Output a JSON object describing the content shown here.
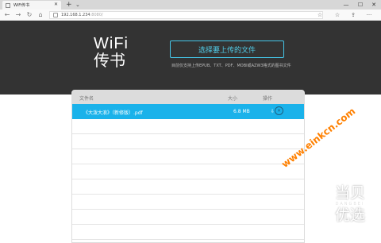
{
  "browser": {
    "tab_title": "WiFi传书",
    "tab_close": "✕",
    "new_tab": "+",
    "tab_list": "⌄",
    "url_host": "192.168.1.234",
    "url_port": ":8080/",
    "back": "←",
    "forward": "→",
    "refresh": "↻",
    "home": "⌂",
    "win_min": "—",
    "win_max": "☐",
    "win_close": "✕",
    "fav_star": "☆",
    "collections": "☆",
    "share": "⇪",
    "more": "···"
  },
  "header": {
    "brand_line1": "WiFi",
    "brand_line2": "传书",
    "upload_button": "选择要上传的文件",
    "hint_text": "目前仅支持上传EPUB、TXT、PDF、MOBI或AZW3格式的图书文件"
  },
  "file_list": {
    "columns": {
      "name": "文件名",
      "size": "大小",
      "actions": "操作"
    },
    "files": [
      {
        "name": "《大泼大浪》（新修版）.pdf",
        "size": "6.8 MB",
        "download_icon": "⇩",
        "delete_icon": "✕"
      }
    ]
  },
  "watermark": {
    "site": "www.einkcn.com",
    "logo_top": "当贝",
    "logo_sub": "DANGBEI",
    "logo_bottom": "优选"
  },
  "colors": {
    "header_bg": "#333333",
    "accent": "#1ab2ea",
    "button_border": "#45c6e8"
  }
}
